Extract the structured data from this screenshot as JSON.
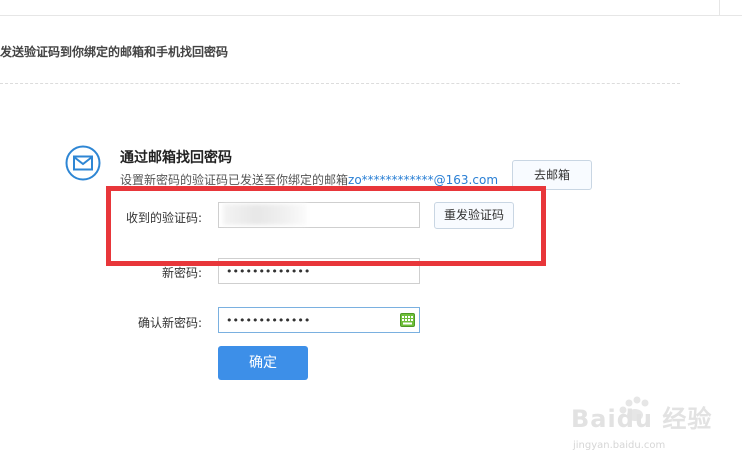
{
  "header": {
    "subtitle": "发送验证码到你绑定的邮箱和手机找回密码"
  },
  "section": {
    "title": "通过邮箱找回密码",
    "notice_prefix": "设置新密码的验证码已发送至你绑定的邮箱",
    "notice_email": "zo************@163.com",
    "goto_mail_label": "去邮箱",
    "icon": "envelope-icon"
  },
  "form": {
    "code_label": "收到的验证码:",
    "code_value": "",
    "resend_label": "重发验证码",
    "new_password_label": "新密码:",
    "new_password_value": "•••••••••••••",
    "confirm_password_label": "确认新密码:",
    "confirm_password_value": "•••••••••••••",
    "keyboard_icon": "keyboard-icon",
    "submit_label": "确定"
  },
  "watermark": {
    "brand": "Baidu 经验",
    "url": "jingyan.baidu.com"
  },
  "colors": {
    "accent": "#3d8fe8",
    "highlight": "#e8363a",
    "link": "#2a7fd4"
  }
}
